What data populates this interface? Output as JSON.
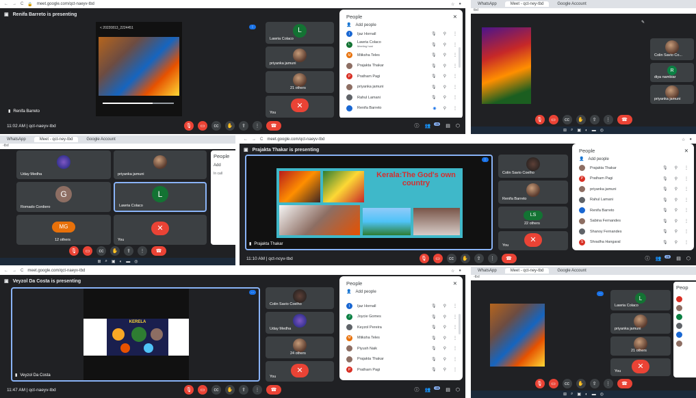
{
  "p1": {
    "url": "meet.google.com/qct-naeyv-tbd",
    "presenting": "Renifa Barreto is presenting",
    "phone_title": "< 20220813_2224451",
    "stage_name": "Renifa Barreto",
    "tiles": [
      {
        "name": "Lawria Colaco",
        "letter": "L",
        "color": "#137333"
      },
      {
        "name": "priyanka jamuni",
        "letter": "",
        "color": ""
      },
      {
        "name": "21 others",
        "letter": "",
        "color": ""
      },
      {
        "name": "You",
        "letter": "",
        "color": ""
      }
    ],
    "time": "11:02 AM | qct-naeyv-tbd",
    "people_title": "People",
    "add_people": "Add people",
    "badge": "25",
    "rows": [
      {
        "name": "Ijaz Hornall",
        "letter": "I",
        "color": "#1967d2"
      },
      {
        "name": "Lawria Colaco",
        "sub": "Meeting host",
        "letter": "L",
        "color": "#137333"
      },
      {
        "name": "Miiksha Teles",
        "letter": "M",
        "color": "#e8710a"
      },
      {
        "name": "Prajakta Thakar",
        "letter": "",
        "color": "#8d6e63"
      },
      {
        "name": "Pratham Pagi",
        "letter": "P",
        "color": "#d93025"
      },
      {
        "name": "priyanka jamuni",
        "letter": "",
        "color": "#8d6e63"
      },
      {
        "name": "Rahul Lamani",
        "letter": "",
        "color": "#5f6368"
      },
      {
        "name": "Renifa Barreto",
        "letter": "",
        "color": "#1967d2"
      }
    ]
  },
  "p2": {
    "tabs": [
      "WhatsApp",
      "Meet - qct-ney-tbd",
      "Google Account"
    ],
    "addr": "tbd",
    "tiles": [
      {
        "name": "Colin Savio Co...",
        "letter": "",
        "color": ""
      },
      {
        "name": "diya nambiar",
        "letter": "R",
        "color": "#0b8043"
      },
      {
        "name": "priyanka jamuni",
        "letter": "",
        "color": ""
      }
    ]
  },
  "p3": {
    "tabs": [
      "WhatsApp",
      "Meet - qct-ney-tbd",
      "Google Account"
    ],
    "addr": "-tbd",
    "tiles": [
      {
        "name": "Uday Medha",
        "letter": "",
        "color": ""
      },
      {
        "name": "priyanka jamuni",
        "letter": "",
        "color": ""
      },
      {
        "name": "Romado Cordiero",
        "letter": "G",
        "color": "#8d6e63"
      },
      {
        "name": "Lawria Colaco",
        "letter": "L",
        "color": "#137333"
      },
      {
        "name": "12 others",
        "letter": "MG",
        "color": "#e8710a"
      },
      {
        "name": "You",
        "letter": "",
        "color": ""
      }
    ],
    "side_title": "People",
    "side_add": "Add",
    "side_call": "In call"
  },
  "p4": {
    "url": "meet.google.com/qct-naeyv-tbd",
    "presenting": "Prajakta Thakar is presenting",
    "slide_title": "Kerala:The God's own country",
    "stage_name": "Prajakta Thakar",
    "tiles": [
      {
        "name": "Colin Savio Coelho",
        "letter": "",
        "color": ""
      },
      {
        "name": "Renifa Barreto",
        "letter": "",
        "color": ""
      },
      {
        "name": "22 others",
        "letter": "LS",
        "color": "#137333"
      },
      {
        "name": "You",
        "letter": "",
        "color": ""
      }
    ],
    "time": "11:10 AM | qct-ncyv-tbd",
    "people_title": "People",
    "add_people": "Add people",
    "badge": "25",
    "rows": [
      {
        "name": "Prajakta Thakar",
        "letter": "",
        "color": "#8d6e63"
      },
      {
        "name": "Pratham Pagi",
        "letter": "P",
        "color": "#d93025"
      },
      {
        "name": "priyanka jamuni",
        "letter": "",
        "color": "#8d6e63"
      },
      {
        "name": "Rahul Lamani",
        "letter": "",
        "color": "#5f6368"
      },
      {
        "name": "Renifa Barreto",
        "letter": "",
        "color": "#1967d2"
      },
      {
        "name": "Sabina Fernandes",
        "letter": "",
        "color": "#8d6e63"
      },
      {
        "name": "Shanoy Fernandes",
        "letter": "",
        "color": "#5f6368"
      },
      {
        "name": "Shradha Hangaral",
        "letter": "S",
        "color": "#d93025"
      }
    ]
  },
  "p5": {
    "url": "meet.google.com/qct-naeyv-tbd",
    "presenting": "Veyzol Da Costa is presenting",
    "slide_title": "KERELA",
    "stage_name": "Veyzol Da Costa",
    "tiles": [
      {
        "name": "Colin Savio Coelho",
        "letter": "",
        "color": ""
      },
      {
        "name": "Uday Medha",
        "letter": "",
        "color": ""
      },
      {
        "name": "24 others",
        "letter": "",
        "color": ""
      },
      {
        "name": "You",
        "letter": "",
        "color": ""
      }
    ],
    "time": "11:47 AM | qct-naeyv-tbd",
    "people_title": "People",
    "add_people": "Add people",
    "badge": "28",
    "rows": [
      {
        "name": "Ijaz Hornall",
        "letter": "I",
        "color": "#1967d2"
      },
      {
        "name": "Joycie Gomes",
        "letter": "J",
        "color": "#0b8043"
      },
      {
        "name": "Keyzol Pereira",
        "letter": "",
        "color": "#5f6368"
      },
      {
        "name": "Miiksha Teles",
        "letter": "M",
        "color": "#e8710a"
      },
      {
        "name": "Piyush Naik",
        "letter": "",
        "color": "#8d6e63"
      },
      {
        "name": "Prajakta Thakar",
        "letter": "",
        "color": "#8d6e63"
      },
      {
        "name": "Pratham Pagi",
        "letter": "P",
        "color": "#d93025"
      }
    ]
  },
  "p6": {
    "tabs": [
      "WhatsApp",
      "Meet - qct-ney-tbd",
      "Google Account"
    ],
    "addr": "-tbd",
    "tiles": [
      {
        "name": "Lawria Colaco",
        "letter": "L",
        "color": "#137333"
      },
      {
        "name": "priyanka jamuni",
        "letter": "",
        "color": ""
      },
      {
        "name": "21 others",
        "letter": "",
        "color": ""
      },
      {
        "name": "You",
        "letter": "",
        "color": ""
      }
    ],
    "side_title": "Peop"
  }
}
